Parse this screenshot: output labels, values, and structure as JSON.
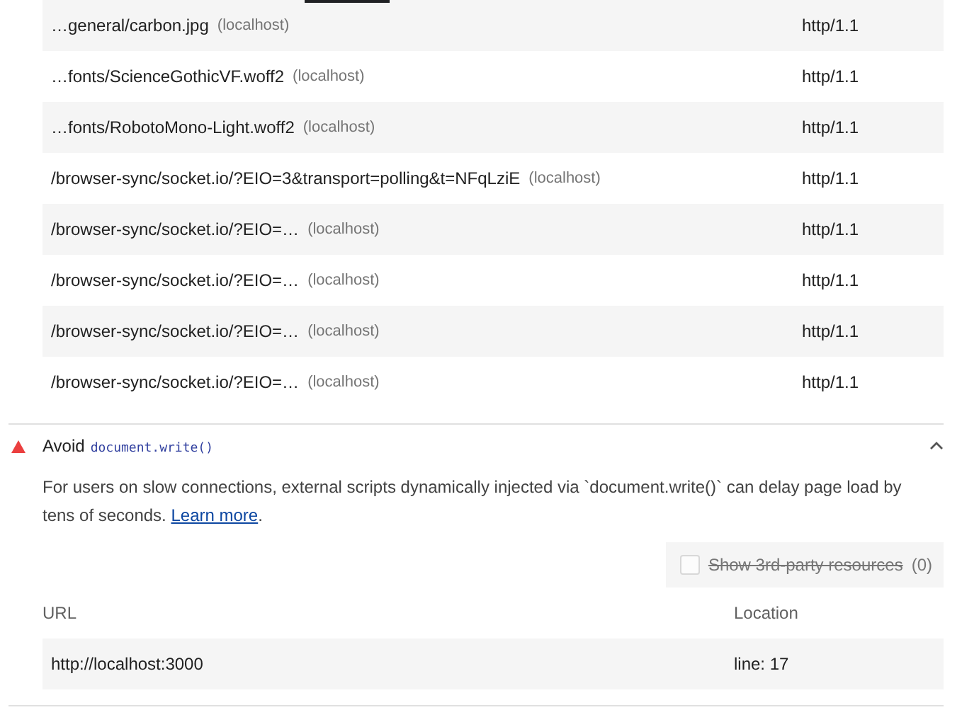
{
  "requests_table": {
    "rows": [
      {
        "url": "…general/carbon.jpg",
        "host": "(localhost)",
        "protocol": "http/1.1"
      },
      {
        "url": "…fonts/ScienceGothicVF.woff2",
        "host": "(localhost)",
        "protocol": "http/1.1"
      },
      {
        "url": "…fonts/RobotoMono-Light.woff2",
        "host": "(localhost)",
        "protocol": "http/1.1"
      },
      {
        "url": "/browser-sync/socket.io/?EIO=3&transport=polling&t=NFqLziE",
        "host": "(localhost)",
        "protocol": "http/1.1"
      },
      {
        "url": "/browser-sync/socket.io/?EIO=…",
        "host": "(localhost)",
        "protocol": "http/1.1"
      },
      {
        "url": "/browser-sync/socket.io/?EIO=…",
        "host": "(localhost)",
        "protocol": "http/1.1"
      },
      {
        "url": "/browser-sync/socket.io/?EIO=…",
        "host": "(localhost)",
        "protocol": "http/1.1"
      },
      {
        "url": "/browser-sync/socket.io/?EIO=…",
        "host": "(localhost)",
        "protocol": "http/1.1"
      }
    ]
  },
  "audit": {
    "title": "Avoid",
    "code": "document.write()",
    "expanded": true,
    "description_before": "For users on slow connections, external scripts dynamically injected via `document.write()` can delay page load by tens of seconds.",
    "link": "Learn more",
    "description_after": ".",
    "third_party": {
      "label": "Show 3rd-party resources",
      "count": "(0)",
      "checked": false,
      "disabled": true
    },
    "table": {
      "columns": [
        "URL",
        "Location"
      ],
      "rows": [
        {
          "url": "http://localhost:3000",
          "location": "line: 17"
        }
      ]
    }
  }
}
